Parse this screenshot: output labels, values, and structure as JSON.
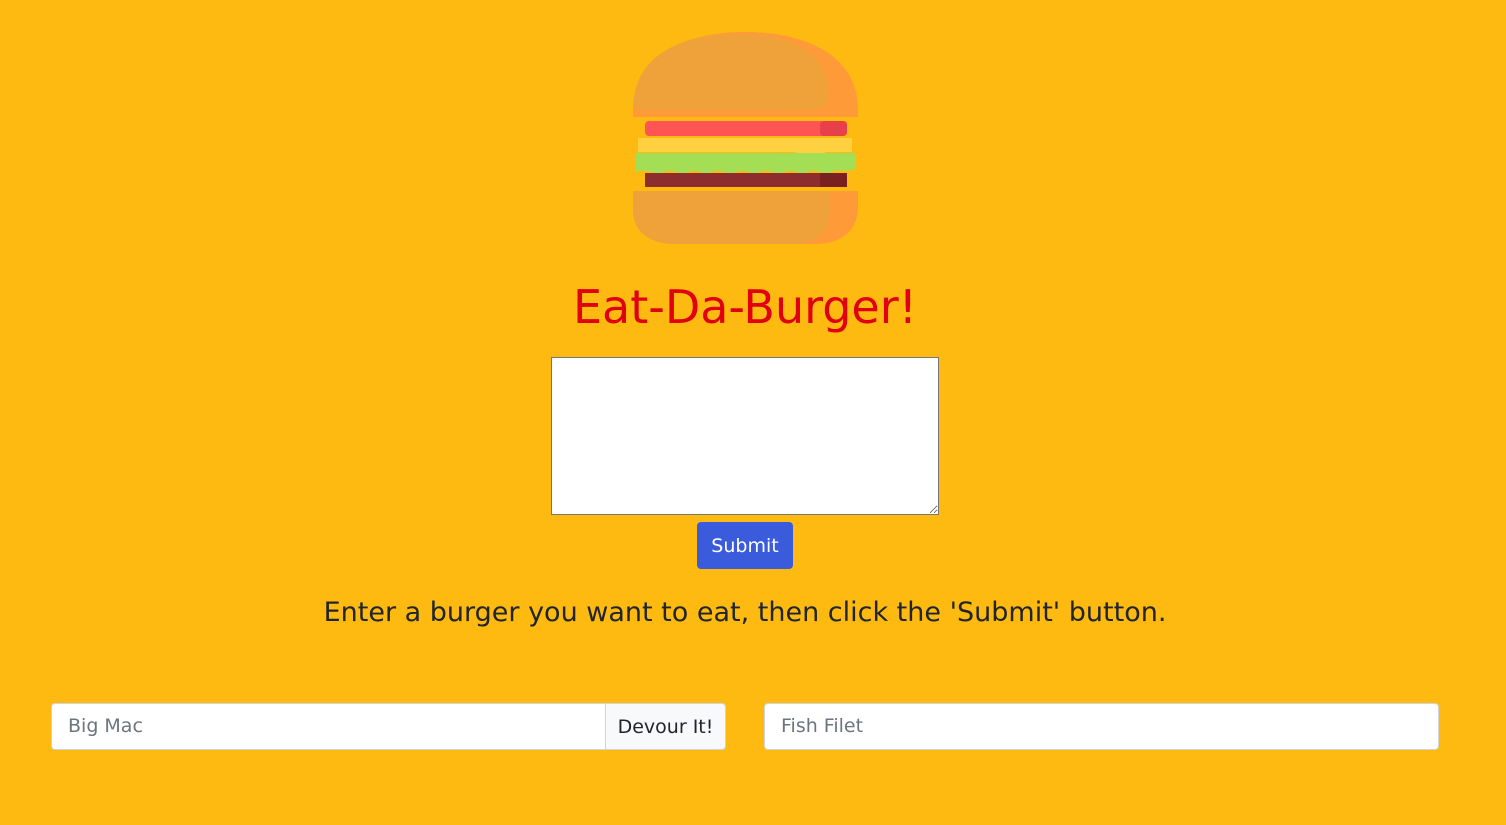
{
  "app": {
    "title": "Eat-Da-Burger!",
    "logo_icon": "burger-icon"
  },
  "form": {
    "textarea_value": "",
    "submit_label": "Submit"
  },
  "instructions": "Enter a burger you want to eat, then click the 'Submit' button.",
  "burgers": {
    "to_eat": [
      {
        "name": "Big Mac",
        "action_label": "Devour It!"
      }
    ],
    "devoured": [
      {
        "name": "Fish Filet"
      }
    ]
  },
  "colors": {
    "background": "#FEBA10",
    "title": "#E00012",
    "submit_button": "#3A5BDC"
  }
}
